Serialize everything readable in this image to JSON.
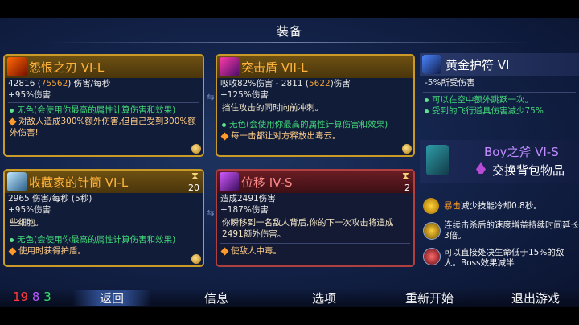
{
  "screen_title": "装备",
  "cards": [
    {
      "name": "怨恨之刃 VI-L",
      "stat_prefix": "42816 (",
      "stat_hl": "75562",
      "stat_suffix": ") 伤害/每秒",
      "line2": "+95%伤害",
      "green": "无色(会使用你最高的属性计算伤害和效果)",
      "effect": "对敌人造成300%额外伤害,但自己受到300%额外伤害!"
    },
    {
      "name": "突击盾 VII-L",
      "stat_prefix": "吸收82%伤害 - 2811 (",
      "stat_hl": "5622",
      "stat_suffix": ")伤害",
      "line2": "+125%伤害",
      "body": "挡住攻击的同时向前冲刺。",
      "green": "无色(会使用你最高的属性计算伤害和效果)",
      "effect": "每一击都让对方释放出毒云。"
    },
    {
      "name": "收藏家的针筒 VI-L",
      "cooldown": "20",
      "stat": "2965 伤害/每秒 (5秒)",
      "line2": "+95%伤害",
      "body": "些细胞。",
      "green": "无色(会使用你最高的属性计算伤害和效果)",
      "effect": "使用时获得护盾。"
    },
    {
      "name": "位移 IV-S",
      "cooldown": "2",
      "stat": "造成2491伤害",
      "line2": "+187%伤害",
      "body": "你瞬移到一名敌人背后,你的下一次攻击将造成2491额外伤害。",
      "effect": "使敌人中毒。"
    }
  ],
  "amulet": {
    "name": "黄金护符 VI",
    "line1": "-5%所受伤害",
    "green1": "可以在空中额外跳跃一次。",
    "green2": "受到的飞行道具伤害减少75%"
  },
  "outfit": {
    "name": "Boy之斧 VI-S",
    "action": "交换背包物品"
  },
  "abilities": [
    {
      "hl": "暴击",
      "text": "减少技能冷却0.8秒。"
    },
    {
      "text": "连续击杀后的速度增益持续时间延长3倍。"
    },
    {
      "text": "可以直接处决生命低于15%的敌人。Boss效果减半"
    }
  ],
  "gems": {
    "red": "19",
    "purple": "8",
    "green": "3"
  },
  "menu": [
    "返回",
    "信息",
    "选项",
    "重新开始",
    "退出游戏"
  ],
  "colors": {
    "gold_border": "#c99a28",
    "red_border": "#b04040",
    "accent_orange": "#ffb23a",
    "green_text": "#42d67a"
  }
}
